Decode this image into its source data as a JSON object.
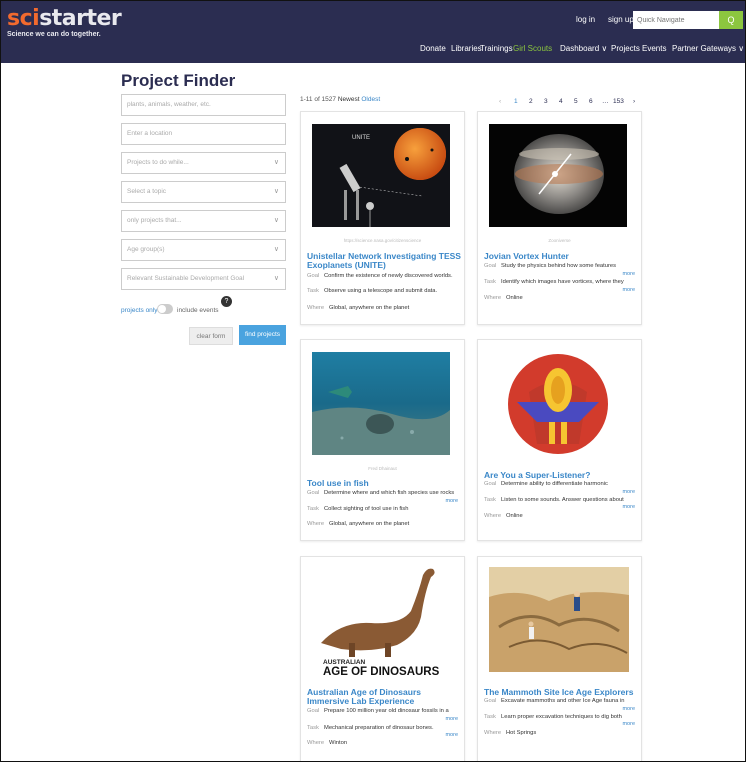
{
  "header": {
    "logo_sci": "sci",
    "logo_starter": "starter",
    "tagline": "Science we can do together.",
    "login": "log in",
    "signup": "sign up",
    "quick_placeholder": "Quick Navigate",
    "quick_btn": "Q",
    "nav": [
      "Donate",
      "Libraries",
      "Trainings",
      "Girl Scouts",
      "Dashboard ∨",
      "Projects",
      "Events",
      "Partner Gateways ∨"
    ]
  },
  "finder": {
    "title": "Project Finder",
    "fields": [
      {
        "text": "plants, animals, weather, etc.",
        "select": false
      },
      {
        "text": "Enter a location",
        "select": false
      },
      {
        "text": "Projects to do while...",
        "select": true
      },
      {
        "text": "Select a topic",
        "select": true
      },
      {
        "text": "only projects that...",
        "select": true
      },
      {
        "text": "Age group(s)",
        "select": true
      },
      {
        "text": "Relevant Sustainable Development Goal",
        "select": true
      }
    ],
    "projects_only": "projects only",
    "include_events": "include events",
    "help": "?",
    "clear": "clear form",
    "find": "find projects"
  },
  "results": {
    "count": "1-11 of 1527",
    "newest": "Newest",
    "oldest": "Oldest",
    "pager": [
      "‹",
      "1",
      "2",
      "3",
      "4",
      "5",
      "6",
      "…",
      "153",
      "›"
    ]
  },
  "cards": [
    {
      "credit": "https://science.nasa.gov/citizenscience",
      "title": "Unistellar Network Investigating TESS Exoplanets (UNITE)",
      "goal": "Confirm the existence of newly discovered worlds.",
      "task": "Observe using a telescope and submit data.",
      "where": "Global, anywhere on the planet",
      "goal_more": false,
      "task_more": false
    },
    {
      "credit": "Zooniverse",
      "title": "Jovian Vortex Hunter",
      "goal": "Study the physics behind how some features",
      "task": "Identify which images have vortices, where they",
      "where": "Online",
      "goal_more": true,
      "task_more": true
    },
    {
      "credit": "Fred Dhainaut",
      "title": "Tool use in fish",
      "goal": "Determine where and which fish species use rocks",
      "task": "Collect sighting of tool use in fish",
      "where": "Global, anywhere on the planet",
      "goal_more": true,
      "task_more": false
    },
    {
      "credit": "",
      "title": "Are You a Super-Listener?",
      "goal": "Determine ability to differentiate harmonic",
      "task": "Listen to some sounds. Answer questions about",
      "where": "Online",
      "goal_more": true,
      "task_more": true
    },
    {
      "credit": "",
      "title": "Australian Age of Dinosaurs Immersive Lab Experience",
      "goal": "Prepare 100 million year old dinosaur fossils in a",
      "task": "Mechanical preparation of dinosaur bones.",
      "where": "Winton",
      "goal_more": true,
      "task_more": true,
      "img_label_small": "AUSTRALIAN",
      "img_label_big": "AGE OF DINOSAURS"
    },
    {
      "credit": "",
      "title": "The Mammoth Site Ice Age Explorers",
      "goal": "Excavate mammoths and other Ice Age fauna in",
      "task": "Learn proper excavation techniques to dig both",
      "where": "Hot Springs",
      "goal_more": true,
      "task_more": true
    }
  ],
  "labels": {
    "goal": "Goal",
    "task": "Task",
    "where": "Where",
    "more": "more"
  },
  "images": {
    "unite_title": "UNITE"
  },
  "colors": {
    "header_bg": "#2b2d51",
    "accent_orange": "#f26a2e",
    "link_blue": "#3a87c8",
    "green": "#8cc63f",
    "button_blue": "#4aa3df"
  }
}
